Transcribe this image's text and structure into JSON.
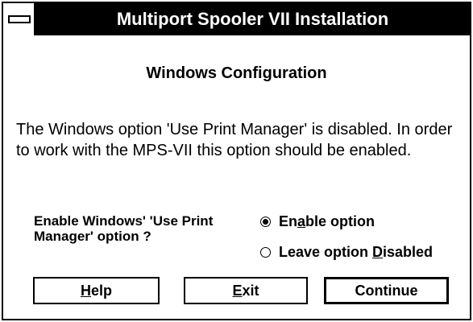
{
  "window": {
    "title": "Multiport Spooler VII Installation",
    "system_menu_icon": "system-menu-icon"
  },
  "heading": "Windows Configuration",
  "message": "The Windows option 'Use Print Manager' is disabled. In order to work with the MPS-VII this option should be enabled.",
  "prompt": "Enable Windows' 'Use Print Manager' option ?",
  "options": [
    {
      "pre": "En",
      "mnemonic": "a",
      "post": "ble option",
      "selected": true
    },
    {
      "pre": "Leave option ",
      "mnemonic": "D",
      "post": "isabled",
      "selected": false
    }
  ],
  "buttons": {
    "help": {
      "mnemonic": "H",
      "rest": "elp"
    },
    "exit": {
      "mnemonic": "E",
      "rest": "xit"
    },
    "continue": {
      "label": "Continue"
    }
  }
}
